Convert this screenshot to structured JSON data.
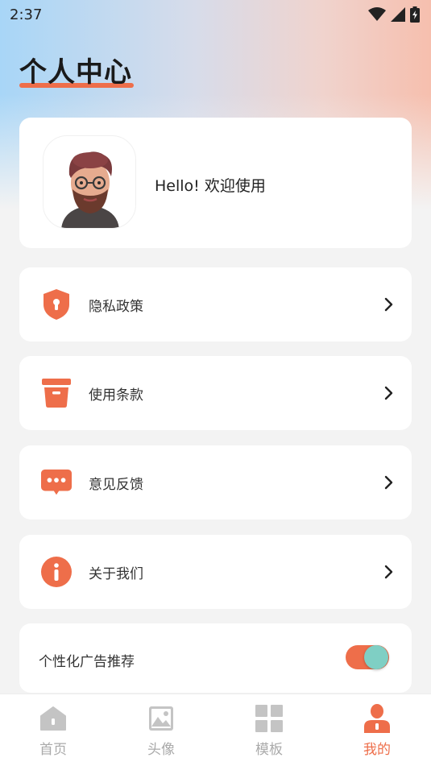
{
  "status_bar": {
    "time": "2:37"
  },
  "header": {
    "title": "个人中心"
  },
  "profile": {
    "greeting": "Hello! 欢迎使用"
  },
  "menu": {
    "items": [
      {
        "label": "隐私政策",
        "icon": "shield-keyhole-icon"
      },
      {
        "label": "使用条款",
        "icon": "terms-box-icon"
      },
      {
        "label": "意见反馈",
        "icon": "chat-bubble-icon"
      },
      {
        "label": "关于我们",
        "icon": "info-icon"
      }
    ]
  },
  "ad_setting": {
    "label": "个性化广告推荐",
    "enabled": true
  },
  "bottom_nav": {
    "items": [
      {
        "label": "首页",
        "icon": "home-icon",
        "active": false
      },
      {
        "label": "头像",
        "icon": "image-icon",
        "active": false
      },
      {
        "label": "模板",
        "icon": "grid-icon",
        "active": false
      },
      {
        "label": "我的",
        "icon": "person-icon",
        "active": true
      }
    ]
  },
  "colors": {
    "accent": "#ee6e4a",
    "toggle_knob": "#7fcfc4",
    "inactive": "#aaaaaa"
  }
}
